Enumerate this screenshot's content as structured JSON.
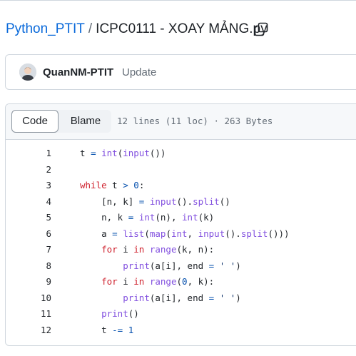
{
  "breadcrumb": {
    "repo": "Python_PTIT",
    "separator": "/",
    "filename": "ICPC0111 - XOAY MẢNG.py"
  },
  "copy_icon": "copy-icon",
  "commit": {
    "author": "QuanNM-PTIT",
    "message": "Update"
  },
  "file_header": {
    "tabs": [
      "Code",
      "Blame"
    ],
    "active_tab": "Code",
    "info": "12 lines (11 loc) · 263 Bytes"
  },
  "code_lines": [
    "t = int(input())",
    "",
    "while t > 0:",
    "    [n, k] = input().split()",
    "    n, k = int(n), int(k)",
    "    a = list(map(int, input().split()))",
    "    for i in range(k, n):",
    "        print(a[i], end = ' ')",
    "    for i in range(0, k):",
    "        print(a[i], end = ' ')",
    "    print()",
    "    t -= 1"
  ],
  "colors": {
    "link": "#0969da",
    "keyword": "#cf222e",
    "function": "#8250df",
    "string": "#0a3069",
    "number": "#0550ae",
    "border": "#d0d7de"
  }
}
